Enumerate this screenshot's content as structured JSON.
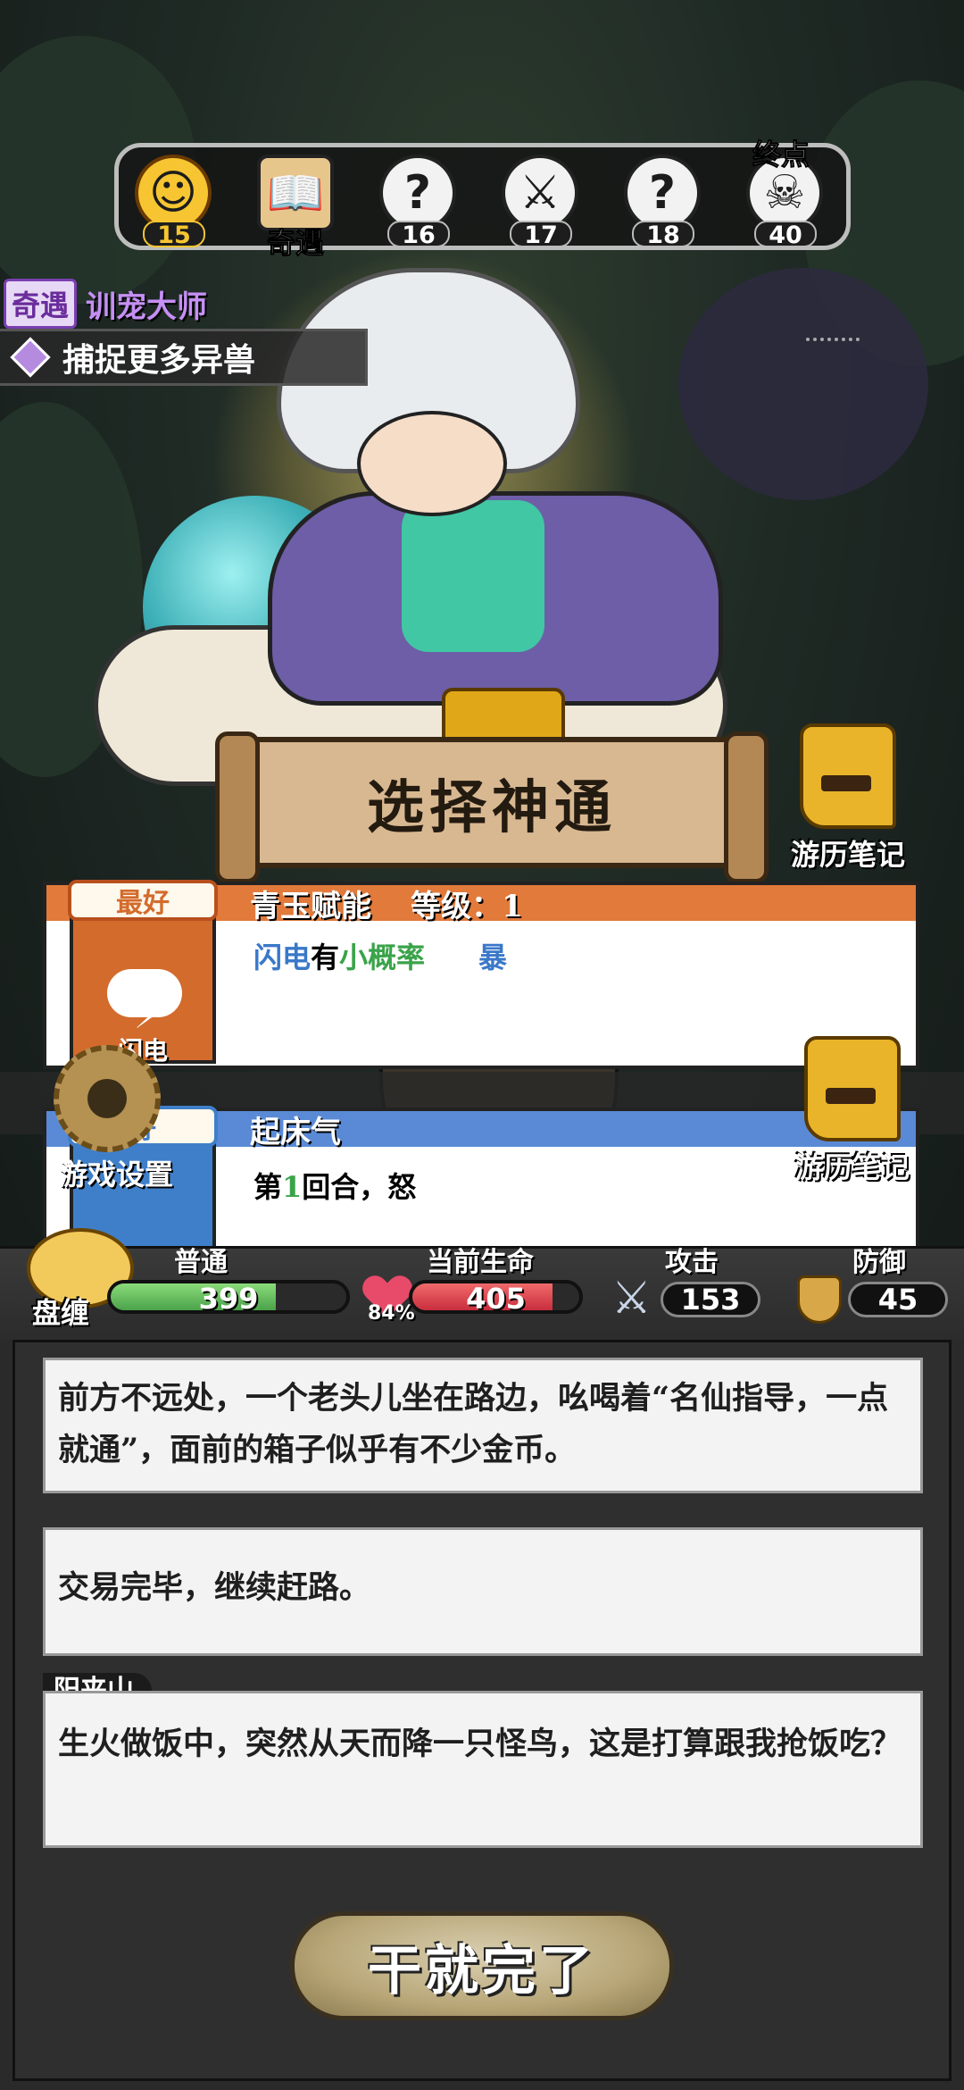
{
  "progress": {
    "nodes": [
      {
        "icon": "happy-face-icon",
        "number": "15",
        "current": true
      },
      {
        "icon": "book-icon",
        "label": "奇遇"
      },
      {
        "icon": "question-icon",
        "number": "16"
      },
      {
        "icon": "crossed-swords-icon",
        "number": "17"
      },
      {
        "icon": "question-icon",
        "number": "18"
      },
      {
        "icon": "skull-icon",
        "number": "40"
      }
    ],
    "end_label": "终点",
    "glyph_question": "?",
    "glyph_swords": "⚔",
    "glyph_skull": "☠"
  },
  "event": {
    "tag": "奇遇",
    "name": "训宠大师",
    "quest": "捕捉更多异兽"
  },
  "banner": {
    "title": "选择神通"
  },
  "notebook": {
    "label": "游历笔记"
  },
  "cards": [
    {
      "badge": "最好",
      "name": "青玉赋能",
      "level_text": "等级：1",
      "icon_caption": "闪电",
      "desc_parts": [
        "闪电",
        "有",
        "小概率",
        "暴"
      ],
      "header_color": "#e27a3b"
    },
    {
      "badge": "好",
      "name": "起床气",
      "desc_parts": [
        "第",
        "1",
        "回合，怒"
      ],
      "header_color": "#5a8ad6"
    }
  ],
  "settings": {
    "label": "游戏设置"
  },
  "stats": {
    "pet_label": "盘缠",
    "rank_label": "普通",
    "gold": "399",
    "hp_label": "当前生命",
    "hp": "405",
    "hp_percent": "84%",
    "hp_fraction": 0.84,
    "atk_label": "攻击",
    "atk": "153",
    "def_label": "防御",
    "def": "45"
  },
  "log": {
    "entries": [
      "前方不远处，一个老头儿坐在路边，吆喝着“名仙指导，一点就通”，面前的箱子似乎有不少金币。",
      "交易完毕，继续赶路。",
      "生火做饭中，突然从天而降一只怪鸟，这是打算跟我抢饭吃？"
    ],
    "location": "阳夹山"
  },
  "action": {
    "label": "干就完了"
  }
}
